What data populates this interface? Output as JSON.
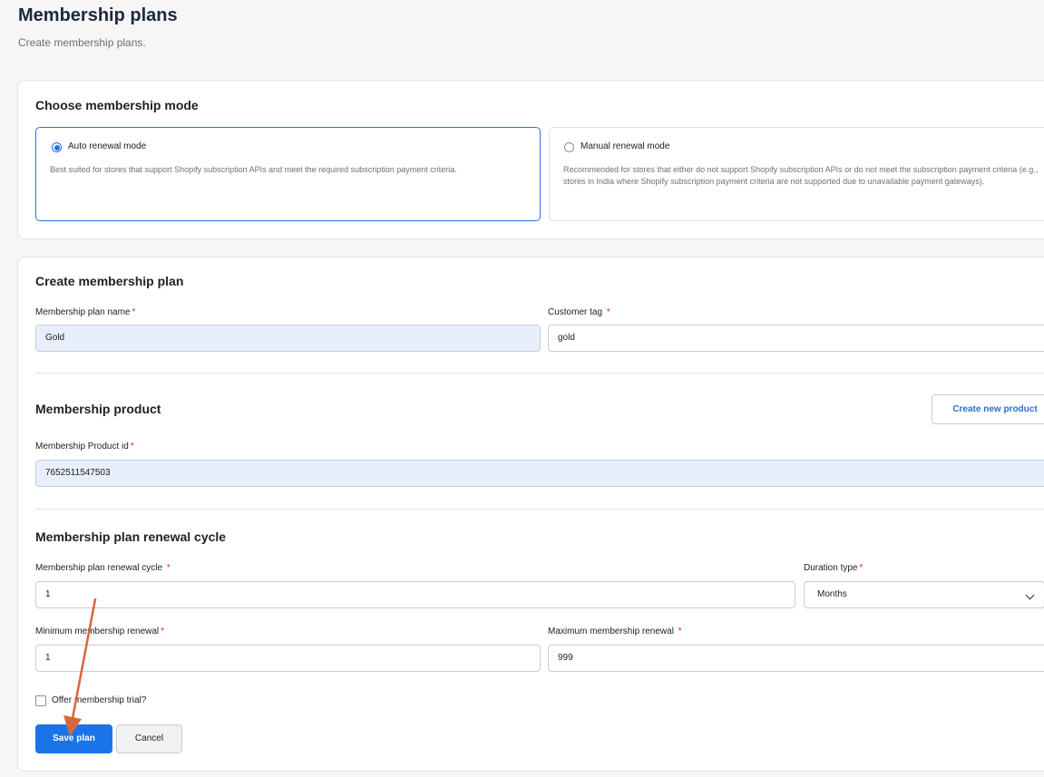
{
  "page": {
    "title": "Membership plans",
    "subtitle": "Create membership plans."
  },
  "mode_section": {
    "title": "Choose membership mode",
    "options": [
      {
        "label": "Auto renewal mode",
        "description": "Best suited for stores that support Shopify subscription APIs and meet the required subscription payment criteria.",
        "selected": true
      },
      {
        "label": "Manual renewal mode",
        "description": "Recommended for stores that either do not support Shopify subscription APIs or do not meet the subscription payment criteria (e.g., stores in India where Shopify subscription payment criteria are not supported due to unavailable payment gateways).",
        "selected": false
      }
    ]
  },
  "plan_section": {
    "title": "Create membership plan",
    "plan_name_label": "Membership plan name",
    "plan_name_value": "Gold",
    "customer_tag_label": "Customer tag",
    "customer_tag_value": "gold",
    "required_marker": "*"
  },
  "product_section": {
    "title": "Membership product",
    "create_button": "Create new product",
    "product_id_label": "Membership Product id",
    "product_id_value": "7652511547503"
  },
  "renewal_section": {
    "title": "Membership plan renewal cycle",
    "cycle_label": "Membership plan renewal cycle",
    "cycle_value": "1",
    "duration_label": "Duration type",
    "duration_value": "Months",
    "min_label": "Minimum membership renewal",
    "min_value": "1",
    "max_label": "Maximum membership renewal",
    "max_value": "999",
    "trial_label": "Offer membership trial?",
    "trial_checked": false
  },
  "actions": {
    "save_label": "Save plan",
    "cancel_label": "Cancel"
  },
  "colors": {
    "primary": "#1a73e8",
    "required": "#d72c0d",
    "annotation_arrow": "#d9663b",
    "filled_input_bg": "#e8eefa"
  }
}
